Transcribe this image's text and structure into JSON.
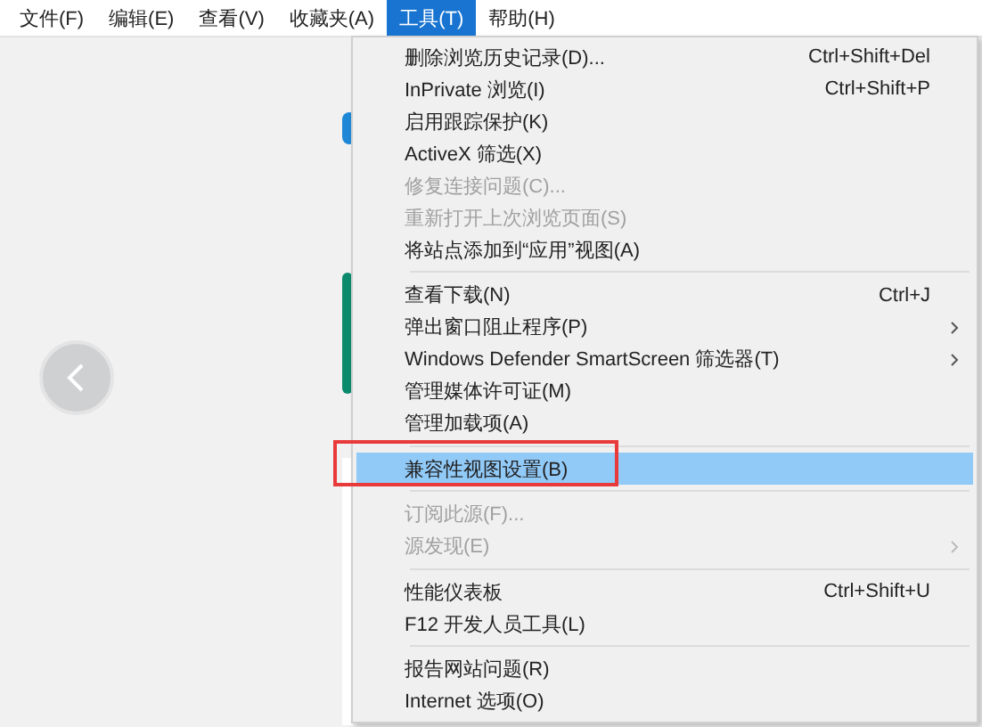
{
  "menubar": [
    {
      "label": "文件(F)",
      "selected": false
    },
    {
      "label": "编辑(E)",
      "selected": false
    },
    {
      "label": "查看(V)",
      "selected": false
    },
    {
      "label": "收藏夹(A)",
      "selected": false
    },
    {
      "label": "工具(T)",
      "selected": true
    },
    {
      "label": "帮助(H)",
      "selected": false
    }
  ],
  "tools_menu": [
    {
      "kind": "item",
      "label": "删除浏览历史记录(D)...",
      "shortcut": "Ctrl+Shift+Del",
      "disabled": false,
      "selected": false
    },
    {
      "kind": "item",
      "label": "InPrivate 浏览(I)",
      "shortcut": "Ctrl+Shift+P",
      "disabled": false,
      "selected": false
    },
    {
      "kind": "item",
      "label": "启用跟踪保护(K)",
      "disabled": false,
      "selected": false
    },
    {
      "kind": "item",
      "label": "ActiveX 筛选(X)",
      "disabled": false,
      "selected": false
    },
    {
      "kind": "item",
      "label": "修复连接问题(C)...",
      "disabled": true,
      "selected": false
    },
    {
      "kind": "item",
      "label": "重新打开上次浏览页面(S)",
      "disabled": true,
      "selected": false
    },
    {
      "kind": "item",
      "label": "将站点添加到“应用”视图(A)",
      "disabled": false,
      "selected": false
    },
    {
      "kind": "separator"
    },
    {
      "kind": "item",
      "label": "查看下载(N)",
      "shortcut": "Ctrl+J",
      "disabled": false,
      "selected": false
    },
    {
      "kind": "submenu",
      "label": "弹出窗口阻止程序(P)",
      "disabled": false,
      "selected": false
    },
    {
      "kind": "submenu",
      "label": "Windows Defender SmartScreen 筛选器(T)",
      "disabled": false,
      "selected": false
    },
    {
      "kind": "item",
      "label": "管理媒体许可证(M)",
      "disabled": false,
      "selected": false
    },
    {
      "kind": "item",
      "label": "管理加载项(A)",
      "disabled": false,
      "selected": false
    },
    {
      "kind": "separator"
    },
    {
      "kind": "item",
      "label": "兼容性视图设置(B)",
      "disabled": false,
      "selected": true,
      "marked": true
    },
    {
      "kind": "separator"
    },
    {
      "kind": "item",
      "label": "订阅此源(F)...",
      "disabled": true,
      "selected": false
    },
    {
      "kind": "submenu",
      "label": "源发现(E)",
      "disabled": true,
      "selected": false
    },
    {
      "kind": "separator"
    },
    {
      "kind": "item",
      "label": "性能仪表板",
      "shortcut": "Ctrl+Shift+U",
      "disabled": false,
      "selected": false
    },
    {
      "kind": "item",
      "label": "F12 开发人员工具(L)",
      "disabled": false,
      "selected": false
    },
    {
      "kind": "separator"
    },
    {
      "kind": "item",
      "label": "报告网站问题(R)",
      "disabled": false,
      "selected": false
    },
    {
      "kind": "item",
      "label": "Internet 选项(O)",
      "disabled": false,
      "selected": false
    }
  ]
}
